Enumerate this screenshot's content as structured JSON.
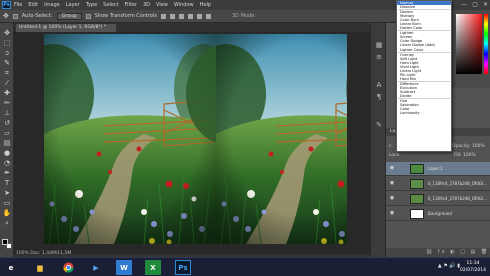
{
  "app": {
    "logo": "Ps",
    "menus": [
      "File",
      "Edit",
      "Image",
      "Layer",
      "Type",
      "Select",
      "Filter",
      "3D",
      "View",
      "Window",
      "Help"
    ],
    "window_controls": [
      "—",
      "▢",
      "✕"
    ]
  },
  "options_bar": {
    "auto_select_label": "Auto-Select:",
    "auto_select_value": "Group",
    "show_transform_label": "Show Transform Controls",
    "mode_3d_label": "3D Mode:"
  },
  "document": {
    "tab_title": "Untitled-1 @ 100% (Layer 1, RGB/8*) *",
    "status": "100%     Doc: 1,44M/11,5M"
  },
  "blend_modes": {
    "groups": [
      [
        "Normal",
        "Dissolve"
      ],
      [
        "Darken",
        "Multiply",
        "Color Burn",
        "Linear Burn",
        "Darker Color"
      ],
      [
        "Lighten",
        "Screen",
        "Color Dodge",
        "Linear Dodge (Add)",
        "Lighter Color"
      ],
      [
        "Overlay",
        "Soft Light",
        "Hard Light",
        "Vivid Light",
        "Linear Light",
        "Pin Light",
        "Hard Mix"
      ],
      [
        "Difference",
        "Exclusion",
        "Subtract",
        "Divide"
      ],
      [
        "Hue",
        "Saturation",
        "Color",
        "Luminosity"
      ]
    ],
    "highlighted": "Normal"
  },
  "layers_panel": {
    "title": "Layers",
    "opacity_label": "Opacity: 100%",
    "lock_label": "Lock:",
    "fill_label": "Fill: 100%",
    "layers": [
      {
        "name": "Layer 1",
        "visible": true,
        "selected": true
      },
      {
        "name": "0_1309c4_2787b248_ORIGI...",
        "visible": true,
        "selected": false
      },
      {
        "name": "0_1309c4_2787b248_ORIGI...",
        "visible": true,
        "selected": false
      },
      {
        "name": "Background",
        "visible": true,
        "selected": false
      }
    ],
    "footer_icons": "⛓ fx ◐ ▢ ▤ 🗑"
  },
  "taskbar": {
    "tray": "▲ ⚑ 🔊 ▮",
    "time": "11:34",
    "date": "02/07/2014"
  },
  "colors": {
    "accent": "#3b78c6",
    "panel": "#535353",
    "taskbar": "#1b1f35"
  }
}
